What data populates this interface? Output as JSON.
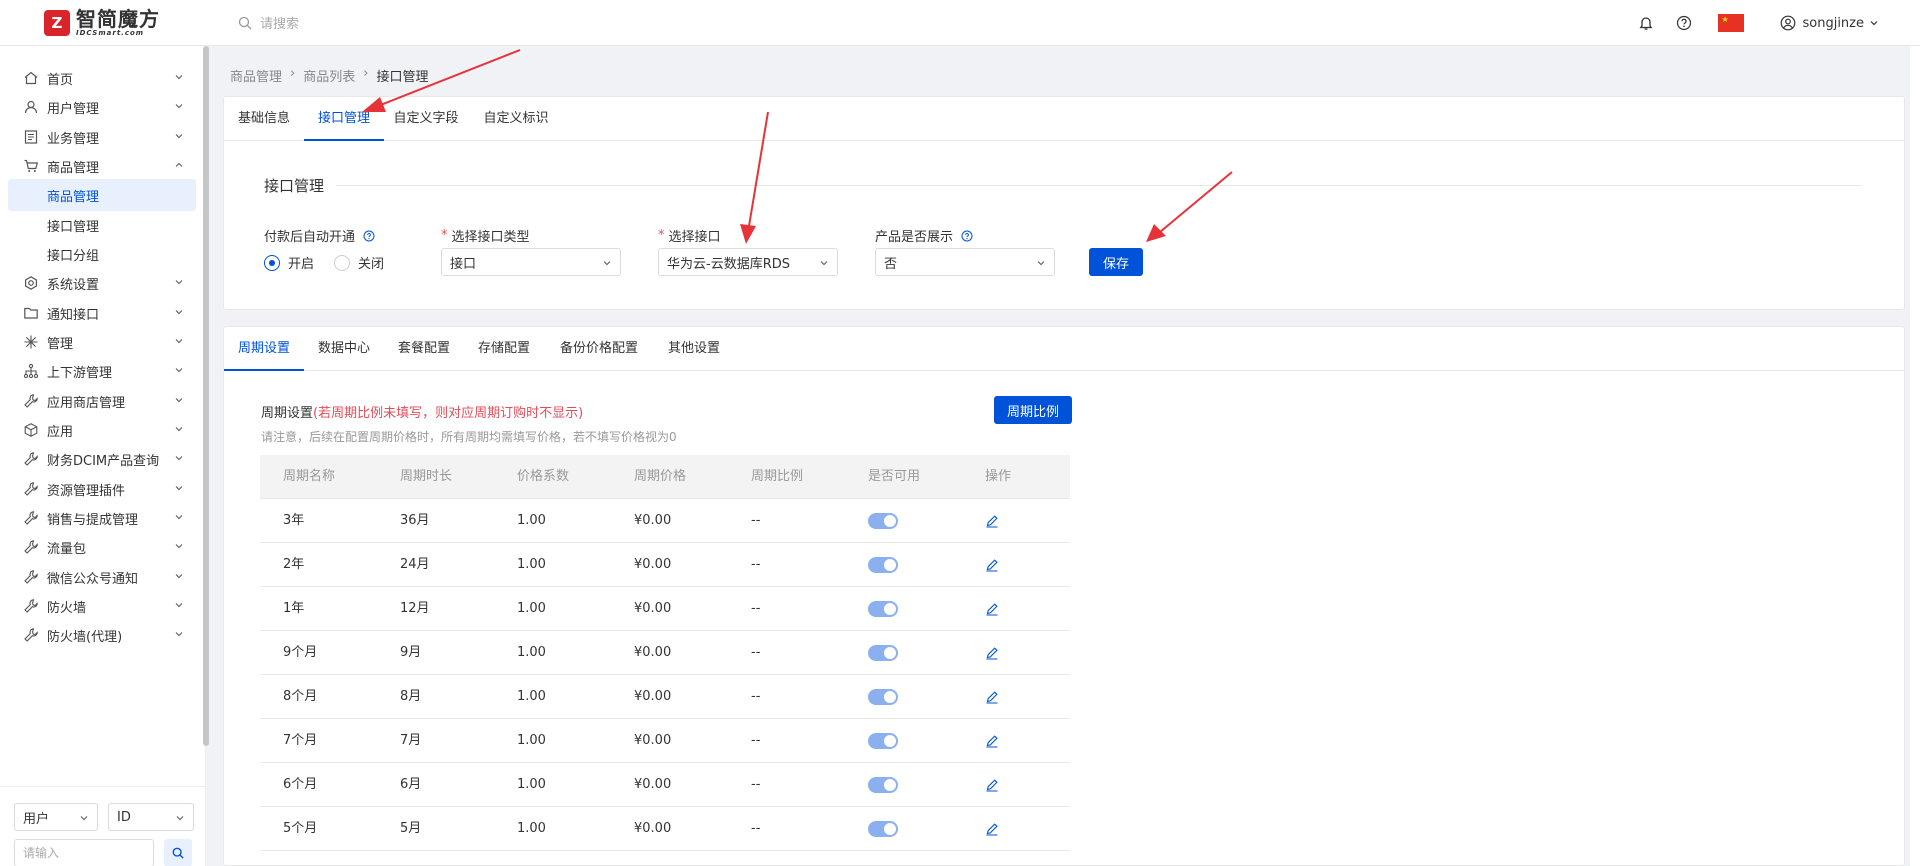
{
  "brand": {
    "name_cn": "智简魔方",
    "name_en": "IDCSmart.com",
    "mark": "Z"
  },
  "header": {
    "search_placeholder": "请搜索",
    "username": "songjinze"
  },
  "sidebar": {
    "items": [
      {
        "label": "首页",
        "icon": "home-icon"
      },
      {
        "label": "用户管理",
        "icon": "user-icon"
      },
      {
        "label": "业务管理",
        "icon": "list-icon"
      },
      {
        "label": "商品管理",
        "icon": "cart-icon"
      },
      {
        "label": "商品管理",
        "sub": true,
        "active": true
      },
      {
        "label": "接口管理",
        "sub": true
      },
      {
        "label": "接口分组",
        "sub": true
      },
      {
        "label": "系统设置",
        "icon": "gear-icon"
      },
      {
        "label": "通知接口",
        "icon": "folder-icon"
      },
      {
        "label": "管理",
        "icon": "sparkle-icon"
      },
      {
        "label": "上下游管理",
        "icon": "hierarchy-icon"
      },
      {
        "label": "应用商店管理",
        "icon": "wrench-icon"
      },
      {
        "label": "应用",
        "icon": "box-icon"
      },
      {
        "label": "财务DCIM产品查询",
        "icon": "wrench-icon"
      },
      {
        "label": "资源管理插件",
        "icon": "wrench-icon"
      },
      {
        "label": "销售与提成管理",
        "icon": "wrench-icon"
      },
      {
        "label": "流量包",
        "icon": "wrench-icon"
      },
      {
        "label": "微信公众号通知",
        "icon": "wrench-icon"
      },
      {
        "label": "防火墙",
        "icon": "wrench-icon"
      },
      {
        "label": "防火墙(代理)",
        "icon": "wrench-icon"
      }
    ],
    "bottom": {
      "type_select": "用户",
      "field_select": "ID",
      "input_placeholder": "请输入"
    }
  },
  "breadcrumb": [
    "商品管理",
    "商品列表",
    "接口管理"
  ],
  "top_tabs": [
    "基础信息",
    "接口管理",
    "自定义字段",
    "自定义标识"
  ],
  "interface_section": {
    "title": "接口管理",
    "auto_open_label": "付款后自动开通",
    "radio_on": "开启",
    "radio_off": "关闭",
    "type_label": "选择接口类型",
    "type_value": "接口",
    "iface_label": "选择接口",
    "iface_value": "华为云-云数据库RDS",
    "show_label": "产品是否展示",
    "show_value": "否",
    "save_label": "保存"
  },
  "sub_tabs": [
    "周期设置",
    "数据中心",
    "套餐配置",
    "存储配置",
    "备份价格配置",
    "其他设置"
  ],
  "cycle": {
    "title": "周期设置",
    "warning": "(若周期比例未填写，则对应周期订购时不显示)",
    "note": "请注意，后续在配置周期价格时，所有周期均需填写价格，若不填写价格视为0",
    "ratio_button": "周期比例",
    "columns": [
      "周期名称",
      "周期时长",
      "价格系数",
      "周期价格",
      "周期比例",
      "是否可用",
      "操作"
    ],
    "rows": [
      {
        "name": "3年",
        "duration": "36月",
        "coef": "1.00",
        "price": "¥0.00",
        "ratio": "--",
        "enabled": true
      },
      {
        "name": "2年",
        "duration": "24月",
        "coef": "1.00",
        "price": "¥0.00",
        "ratio": "--",
        "enabled": true
      },
      {
        "name": "1年",
        "duration": "12月",
        "coef": "1.00",
        "price": "¥0.00",
        "ratio": "--",
        "enabled": true
      },
      {
        "name": "9个月",
        "duration": "9月",
        "coef": "1.00",
        "price": "¥0.00",
        "ratio": "--",
        "enabled": true
      },
      {
        "name": "8个月",
        "duration": "8月",
        "coef": "1.00",
        "price": "¥0.00",
        "ratio": "--",
        "enabled": true
      },
      {
        "name": "7个月",
        "duration": "7月",
        "coef": "1.00",
        "price": "¥0.00",
        "ratio": "--",
        "enabled": true
      },
      {
        "name": "6个月",
        "duration": "6月",
        "coef": "1.00",
        "price": "¥0.00",
        "ratio": "--",
        "enabled": true
      },
      {
        "name": "5个月",
        "duration": "5月",
        "coef": "1.00",
        "price": "¥0.00",
        "ratio": "--",
        "enabled": true
      }
    ]
  },
  "colors": {
    "accent": "#0052d9",
    "danger": "#e34d59",
    "annotation": "#e8323a"
  }
}
